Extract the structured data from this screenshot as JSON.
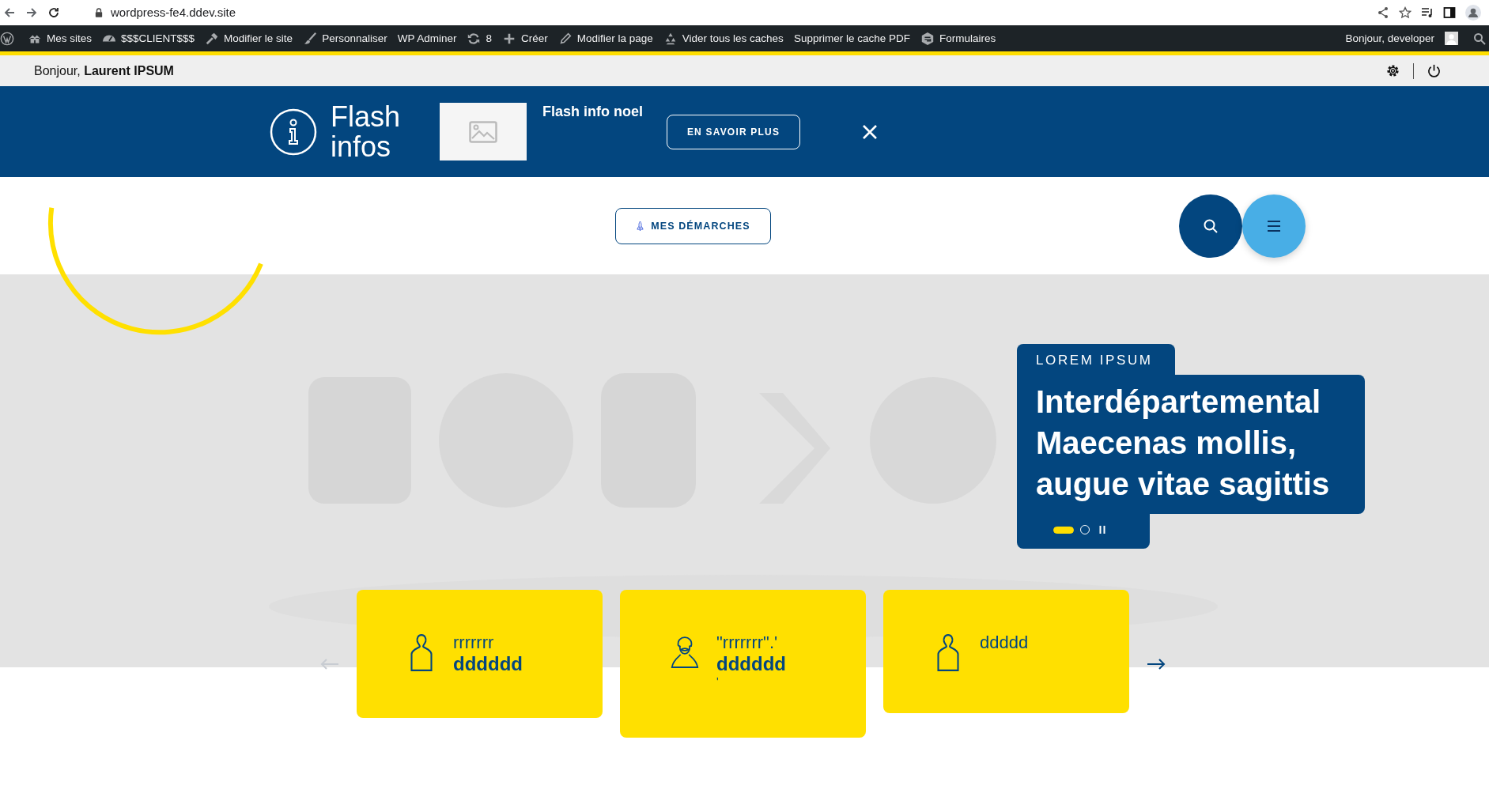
{
  "browser": {
    "url": "wordpress-fe4.ddev.site"
  },
  "admin_bar": {
    "items": [
      {
        "kind": "sites",
        "label": "Mes sites"
      },
      {
        "kind": "gauge",
        "label": "$$$CLIENT$$$"
      },
      {
        "kind": "hammer",
        "label": "Modifier le site"
      },
      {
        "kind": "brush",
        "label": "Personnaliser"
      },
      {
        "kind": "plain",
        "label": "WP Adminer"
      },
      {
        "kind": "refresh",
        "label": "8"
      },
      {
        "kind": "plus",
        "label": "Créer"
      },
      {
        "kind": "pencil",
        "label": "Modifier la page"
      },
      {
        "kind": "recycle",
        "label": "Vider tous les caches"
      },
      {
        "kind": "plain",
        "label": "Supprimer le cache PDF"
      },
      {
        "kind": "form",
        "label": "Formulaires"
      }
    ],
    "account": "Bonjour, developer"
  },
  "greeting": "Bonjour, **Laurent IPSUM**",
  "flash": {
    "title": "Flash infos",
    "headline": "Flash info noel",
    "button": "EN SAVOIR PLUS"
  },
  "header": {
    "button": "MES DÉMARCHES"
  },
  "slider": {
    "label": "LOREM IPSUM",
    "title": "Interdépartemental Maecenas mollis, augue vitae sagittis",
    "dots": [
      {
        "selected": true
      },
      {
        "selected": false
      }
    ]
  },
  "cards": [
    {
      "kind": "person",
      "lines": [
        "rrrrrrr",
        "dddddd"
      ]
    },
    {
      "kind": "bearded",
      "lines": [
        "\"rrrrrrr\".'",
        "dddddd",
        "'"
      ]
    },
    {
      "kind": "person",
      "lines": [
        "ddddd"
      ]
    }
  ],
  "carousel": {
    "prev_disabled": true,
    "next_disabled": false
  }
}
